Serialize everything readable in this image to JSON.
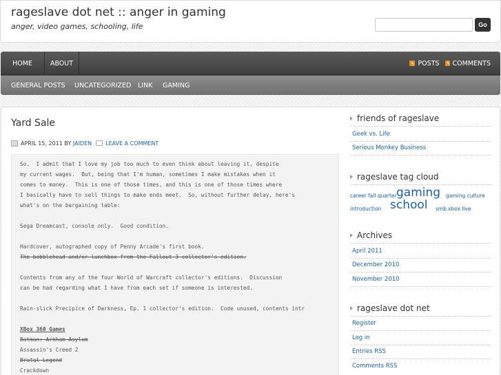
{
  "header": {
    "site_title": "rageslave dot net :: anger in gaming",
    "tagline": "anger, video games, schooling, life",
    "search_placeholder": "",
    "search_button": "Go"
  },
  "nav": {
    "pages": [
      "HOME",
      "ABOUT"
    ],
    "feeds": [
      "POSTS",
      "COMMENTS"
    ],
    "categories": [
      "GENERAL POSTS",
      "UNCATEGORIZED",
      "LINK",
      "GAMING"
    ]
  },
  "post": {
    "title": "Yard Sale",
    "date": "APRIL 15, 2011",
    "by": "BY",
    "author": "JAIDEN",
    "comment_link": "LEAVE A COMMENT",
    "lines": [
      "So.  I admit that I love my job too much to even think about leaving it, despite",
      "my current wages.  But, being that I'm human, sometimes I make mistakes when it",
      "comes to money.  This is one of those times, and this is one of those times where",
      "I basically have to sell things to make ends meet.  So, without further delay, here's",
      "what's on the bargaining table:",
      "Sega Dreamcast, console only.  Good condition.",
      "Hardcover, autographed copy of Penny Arcade's first book.",
      "The bobblehead and/or lunchbox from the Fallout 3 collector's edition.",
      "Contents from any of the four World of Warcraft collector's editions.  Discussion",
      "can be had regarding what I have from each set if someone is interested.",
      "Rain-slick Precipice of Darkness, Ep. 1 collector's edition.  Code unused, contents intr",
      "XBox 360 Games",
      "Batman: Arkham Asylum",
      "Assassin's Creed 2",
      "Brutal Legend",
      "Crackdown"
    ]
  },
  "sidebar": {
    "friends_title": "friends of rageslave",
    "friends": [
      "Geek vs. Life",
      "Serious Monkey Business"
    ],
    "tags_title": "rageslave tag cloud",
    "tags": [
      "career",
      "fall quarter",
      "gaming",
      "gaming culture",
      "introduction",
      "school",
      "smb",
      "xbox live"
    ],
    "archives_title": "Archives",
    "archives": [
      "April 2011",
      "December 2010",
      "November 2010"
    ],
    "meta_title": "rageslave dot net",
    "meta": [
      "Register",
      "Log in",
      "Entries RSS",
      "Comments RSS"
    ]
  },
  "colors": {
    "link": "#1a5fb4",
    "rss": "#f08a24",
    "nav_dark": "#424242",
    "nav_light": "#7a7a7a"
  }
}
